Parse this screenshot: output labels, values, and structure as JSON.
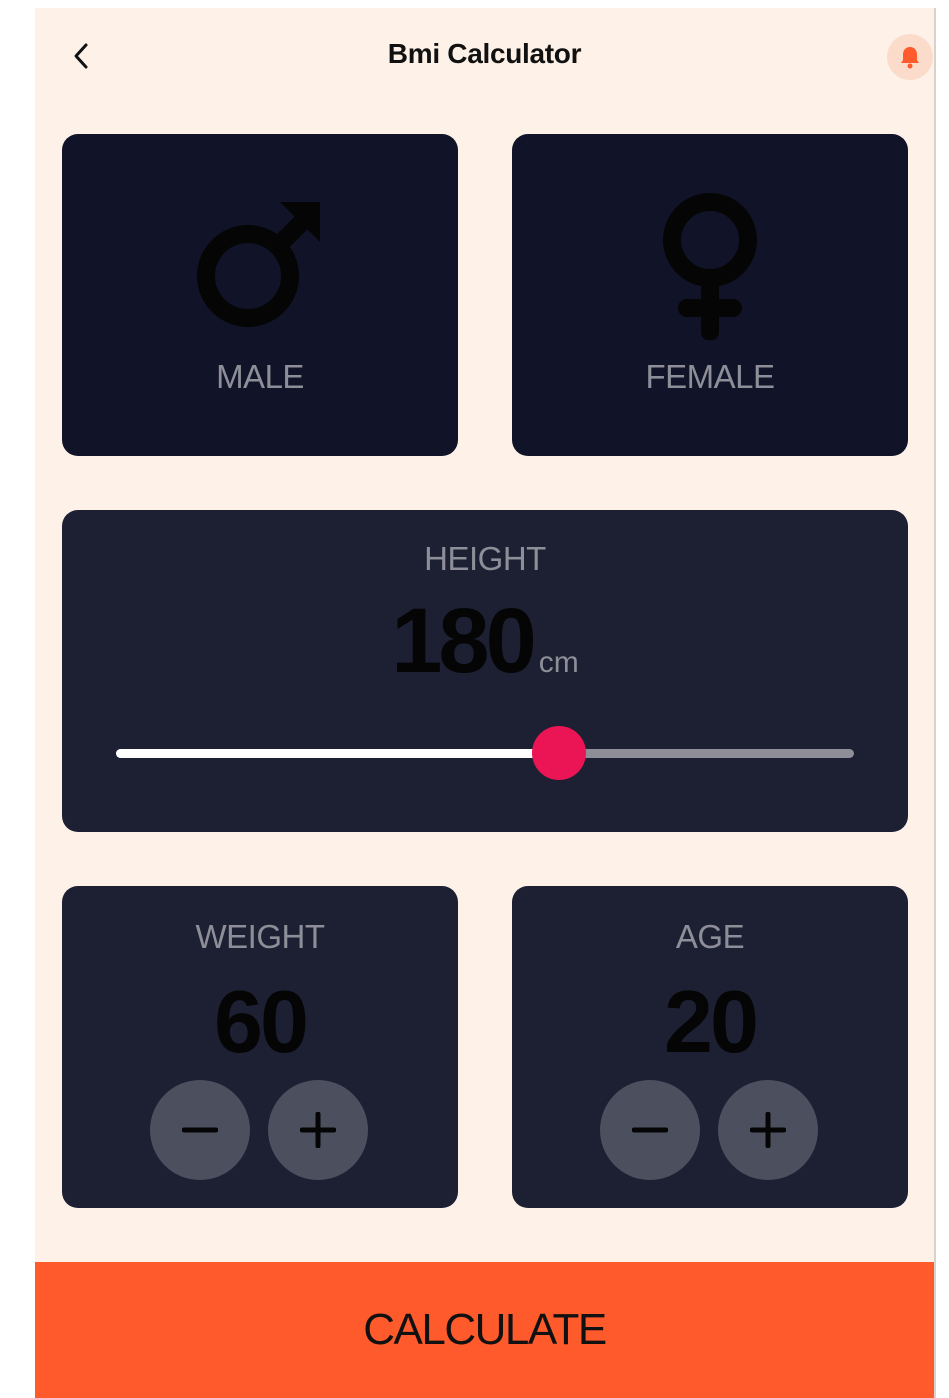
{
  "header": {
    "title": "Bmi Calculator",
    "back_icon": "chevron-left-icon",
    "notification_icon": "bell-icon"
  },
  "gender": {
    "male_label": "MALE",
    "male_icon": "mars-icon",
    "female_label": "FEMALE",
    "female_icon": "venus-icon"
  },
  "height": {
    "label": "HEIGHT",
    "value": "180",
    "unit": "cm",
    "slider_fraction": 0.6
  },
  "weight": {
    "label": "WEIGHT",
    "value": "60"
  },
  "age": {
    "label": "AGE",
    "value": "20"
  },
  "calculate_label": "CALCULATE",
  "colors": {
    "background": "#fdf1e8",
    "card": "#1d1f33",
    "accent": "#eb1555",
    "button": "#ff5a2c",
    "muted_text": "#8d8e98"
  }
}
